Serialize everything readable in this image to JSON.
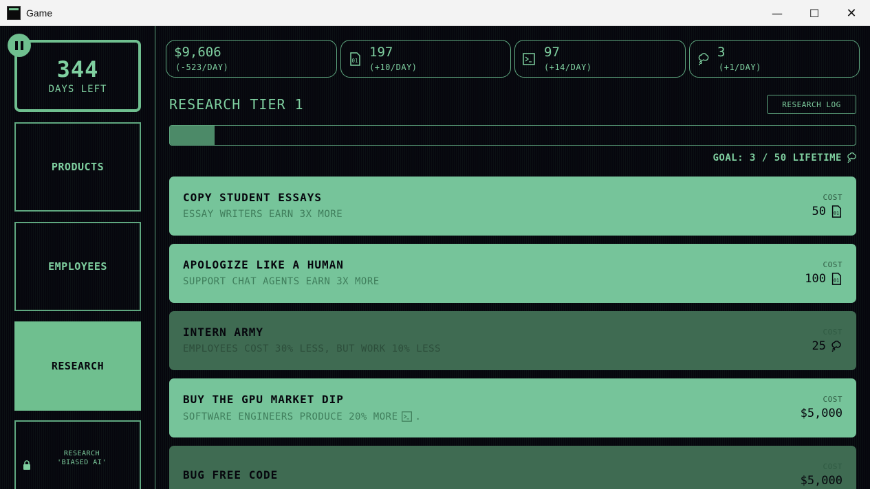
{
  "window": {
    "title": "Game",
    "min_glyph": "—",
    "max_glyph": "☐",
    "close_glyph": "✕"
  },
  "colors": {
    "accent": "#7fd0a0",
    "card": "#76c49a",
    "card_dim": "#3f6b52",
    "background": "#06060d"
  },
  "sidebar": {
    "days_left": "344",
    "days_label": "DAYS LEFT",
    "nav": [
      {
        "label": "PRODUCTS",
        "active": false
      },
      {
        "label": "EMPLOYEES",
        "active": false
      },
      {
        "label": "RESEARCH",
        "active": true
      }
    ],
    "locked_item": {
      "label": "RESEARCH\n'BIASED AI'",
      "icon": "lock-icon"
    }
  },
  "resources": [
    {
      "icon": "none",
      "value": "$9,606",
      "rate": "(-523/DAY)"
    },
    {
      "icon": "data-file-icon",
      "value": "197",
      "rate": "(+10/DAY)"
    },
    {
      "icon": "terminal-icon",
      "value": "97",
      "rate": "(+14/DAY)"
    },
    {
      "icon": "thought-bubble-icon",
      "value": "3",
      "rate": "(+1/DAY)"
    }
  ],
  "research": {
    "tier_title": "RESEARCH TIER 1",
    "log_button": "RESEARCH LOG",
    "progress_fraction": 0.065,
    "goal_text": "GOAL: 3 / 50 LIFETIME",
    "cost_label": "COST",
    "items": [
      {
        "name": "COPY STUDENT ESSAYS",
        "desc": "ESSAY WRITERS EARN 3X MORE",
        "cost": "50",
        "cost_icon": "data-file-icon",
        "affordable": true
      },
      {
        "name": "APOLOGIZE LIKE A HUMAN",
        "desc": "SUPPORT CHAT AGENTS EARN 3X MORE",
        "cost": "100",
        "cost_icon": "data-file-icon",
        "affordable": true
      },
      {
        "name": "INTERN ARMY",
        "desc": "EMPLOYEES COST 30% LESS, BUT WORK 10% LESS",
        "cost": "25",
        "cost_icon": "thought-bubble-icon",
        "affordable": false
      },
      {
        "name": "BUY THE GPU MARKET DIP",
        "desc": "SOFTWARE ENGINEERS PRODUCE 20% MORE",
        "desc_suffix": ".",
        "cost": "$5,000",
        "cost_icon": "none",
        "affordable": true
      },
      {
        "name": "BUG FREE CODE",
        "desc": "",
        "cost": "$5,000",
        "cost_icon": "none",
        "affordable": false
      }
    ]
  }
}
